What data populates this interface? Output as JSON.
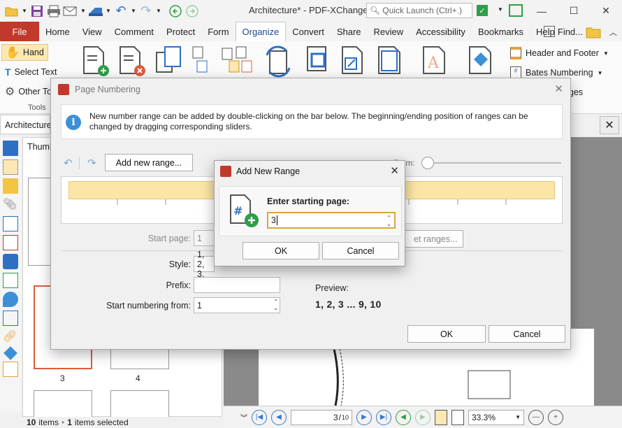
{
  "window": {
    "title": "Architecture* - PDF-XChange ...",
    "quick_launch_placeholder": "Quick Launch (Ctrl+.)"
  },
  "menu": {
    "file": "File",
    "tabs": [
      "Home",
      "View",
      "Comment",
      "Protect",
      "Form",
      "Organize",
      "Convert",
      "Share",
      "Review",
      "Accessibility",
      "Bookmarks",
      "Help"
    ],
    "active_tab": "Organize",
    "find": "Find..."
  },
  "ribbon": {
    "hand": "Hand",
    "select_text": "Select Text",
    "other_tools": "Other To",
    "tools_group": "Tools",
    "header_footer": "Header and Footer",
    "bates_numbering": "Bates Numbering",
    "ranges_fragment": "ges"
  },
  "document": {
    "tab": "Architecture",
    "thumbnails_header": "Thumb",
    "thumb_labels": [
      "3",
      "4"
    ],
    "status_items": "10 items",
    "status_items_count": "10",
    "status_items_word": "items",
    "status_selected_count": "1",
    "status_selected_word": "items selected",
    "page_current": "3",
    "page_total": "10",
    "zoom": "33.3%"
  },
  "page_numbering": {
    "title": "Page Numbering",
    "info": "New number range can be added by double-clicking on the bar below. The beginning/ending position of ranges can be changed by dragging corresponding sliders.",
    "add_range_button": "Add new range...",
    "zoom_label": "Zoom:",
    "zoom_label_visible": "Z  om:",
    "start_page_label": "Start page:",
    "start_page_value": "1",
    "reset_fragment": "et ranges...",
    "style_label": "Style:",
    "style_value": "1, 2, 3, ...",
    "style_value_visible": "1, 2, 3,",
    "prefix_label": "Prefix:",
    "prefix_value": "",
    "start_numbering_label": "Start numbering from:",
    "start_numbering_value": "1",
    "preview_label": "Preview:",
    "preview_value": "1, 2, 3 ... 9, 10",
    "ok": "OK",
    "cancel": "Cancel"
  },
  "add_new_range": {
    "title": "Add New Range",
    "prompt": "Enter starting page:",
    "value": "3",
    "ok": "OK",
    "cancel": "Cancel"
  }
}
